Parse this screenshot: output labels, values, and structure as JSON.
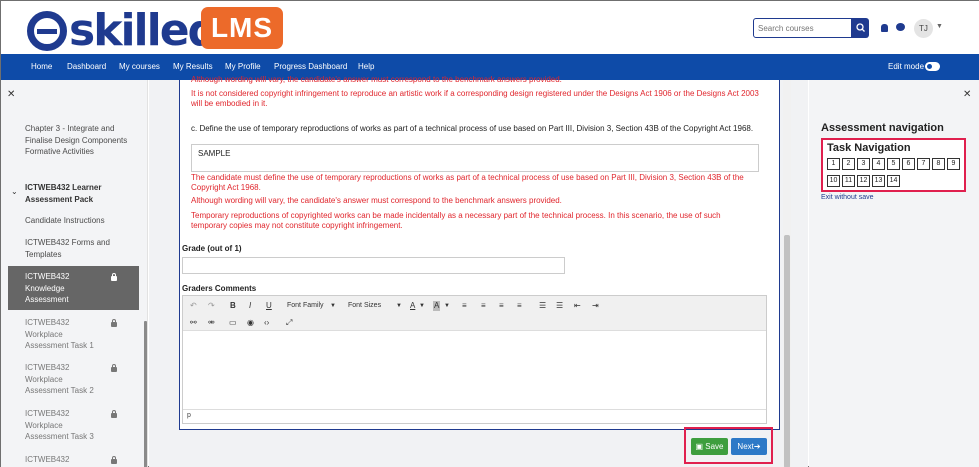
{
  "header": {
    "logo_text": "eskilled",
    "logo_badge": "LMS",
    "search_placeholder": "Search courses",
    "avatar_initials": "TJ"
  },
  "nav": {
    "items": [
      "Home",
      "Dashboard",
      "My courses",
      "My Results",
      "My Profile",
      "Progress Dashboard",
      "Help"
    ],
    "edit_mode_label": "Edit mode"
  },
  "drawer": {
    "items": [
      "Chapter 3 - Integrate and Finalise Design Components Formative Activities",
      "ICTWEB432 Learner Assessment Pack",
      "Candidate Instructions",
      "ICTWEB432 Forms and Templates",
      "ICTWEB432 Knowledge Assessment",
      "ICTWEB432 Workplace Assessment Task 1",
      "ICTWEB432 Workplace Assessment Task 2",
      "ICTWEB432 Workplace Assessment Task 3",
      "ICTWEB432"
    ]
  },
  "main": {
    "red_line_1": "Although wording will vary, the candidate's answer must correspond to the benchmark answers provided.",
    "red_line_2": "It is not considered copyright infringement to reproduce an artistic work if a corresponding design registered under the Designs Act 1906 or the Designs Act 2003 will be embodied in it.",
    "question_c": "c. Define the use of temporary reproductions of works as part of a technical process of use based on Part III, Division 3, Section 43B of the Copyright Act 1968.",
    "answer": "SAMPLE",
    "red_line_3": "The candidate must define the use of temporary reproductions of works as part of a technical process of use based on Part III, Division 3, Section 43B of the Copyright Act 1968.",
    "red_line_4": "Although wording will vary, the candidate's answer must correspond to the benchmark answers provided.",
    "red_line_5": "Temporary reproductions of copyrighted works can be made incidentally as a necessary part of the technical process. In this scenario, the use of such temporary copies may not constitute copyright infringement.",
    "grade_label": "Grade (out of 1)",
    "comments_label": "Graders Comments",
    "toolbar": {
      "font_family": "Font Family",
      "font_sizes": "Font Sizes",
      "bold": "B",
      "italic": "I",
      "underline": "U"
    },
    "editor_status": "p",
    "save_label": "Save",
    "next_label": "Next"
  },
  "right": {
    "assessment_nav_title": "Assessment navigation",
    "task_nav_title": "Task Navigation",
    "tasks": [
      "1",
      "2",
      "3",
      "4",
      "5",
      "6",
      "7",
      "8",
      "9",
      "10",
      "11",
      "12",
      "13",
      "14"
    ],
    "exit_label": "Exit without save"
  }
}
